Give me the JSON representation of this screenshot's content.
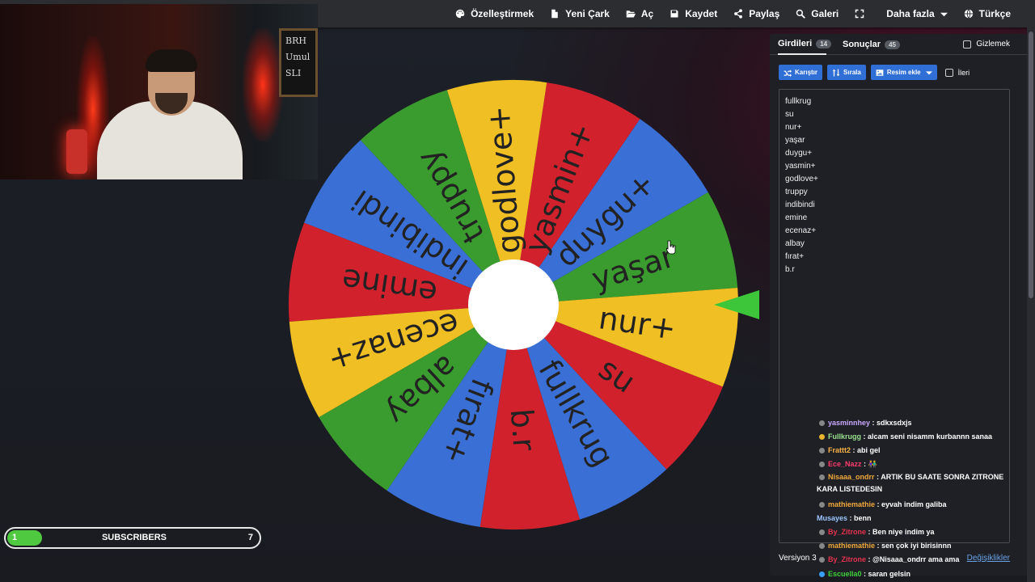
{
  "menu": {
    "customize": "Özelleştirmek",
    "new_wheel": "Yeni Çark",
    "open": "Aç",
    "save": "Kaydet",
    "share": "Paylaş",
    "gallery": "Galeri",
    "more": "Daha fazla",
    "language": "Türkçe"
  },
  "wheel": {
    "segments": [
      {
        "label": "yaşar",
        "color": "#3a9c2e"
      },
      {
        "label": "duygu+",
        "color": "#3a6fd6"
      },
      {
        "label": "yasmin+",
        "color": "#d0212d"
      },
      {
        "label": "godlove+",
        "color": "#f0bf23"
      },
      {
        "label": "truppy",
        "color": "#3a9c2e"
      },
      {
        "label": "indibindi",
        "color": "#3a6fd6"
      },
      {
        "label": "emine",
        "color": "#d0212d"
      },
      {
        "label": "ecenaz+",
        "color": "#f0bf23"
      },
      {
        "label": "albay",
        "color": "#3a9c2e"
      },
      {
        "label": "fırat+",
        "color": "#3a6fd6"
      },
      {
        "label": "b.r",
        "color": "#d0212d"
      },
      {
        "label": "fullkrug",
        "color": "#3a6fd6"
      },
      {
        "label": "su",
        "color": "#d0212d"
      },
      {
        "label": "nur+",
        "color": "#f0bf23"
      }
    ],
    "pointer_color": "#3ec63a"
  },
  "panel": {
    "tab_entries": "Girdileri",
    "entries_count": "14",
    "tab_results": "Sonuçlar",
    "results_count": "45",
    "hide_label": "Gizlemek",
    "shuffle_label": "Karıştır",
    "sort_label": "Sırala",
    "add_image_label": "Resim ekle",
    "advanced_label": "İleri",
    "entries": [
      "fullkrug",
      "su",
      "nur+",
      "yaşar",
      "duygu+",
      "yasmin+",
      "godlove+",
      "truppy",
      "indibindi",
      "emine",
      "ecenaz+",
      "albay",
      "fırat+",
      "b.r"
    ],
    "version": "Versiyon 3",
    "changes_link": "Değişiklikler"
  },
  "chat": [
    {
      "user": "yasminnhey",
      "color": "#c9a8ff",
      "badge": "#888",
      "message": ": sdkxsdxjs"
    },
    {
      "user": "Fullkrugg",
      "color": "#9be28f",
      "badge": "#e8b32d",
      "message": ": alcam seni nisamm kurbannn sanaa"
    },
    {
      "user": "Frattt2",
      "color": "#ffb347",
      "badge": "#888",
      "message": ": abi gel"
    },
    {
      "user": "Ece_Nazz",
      "color": "#ff3b6b",
      "badge": "#888",
      "message": ": 👫"
    },
    {
      "user": "Nisaaa_ondrr",
      "color": "#f2a93b",
      "badge": "#888",
      "message": ": ARTIK BU SAATE SONRA ZITRONE KARA LISTEDESIN"
    },
    {
      "user": "mathiemathie",
      "color": "#f2a93b",
      "badge": "#888",
      "message": ": eyvah indim galiba"
    },
    {
      "user": "Musayes",
      "color": "#9ec7ff",
      "badge": "",
      "message": ": benn"
    },
    {
      "user": "By_Zitrone",
      "color": "#e8324c",
      "badge": "#888",
      "message": ": Ben niye indim ya"
    },
    {
      "user": "mathiemathie",
      "color": "#f2a93b",
      "badge": "#888",
      "message": ": sen çok iyi birisinnn"
    },
    {
      "user": "By_Zitrone",
      "color": "#e8324c",
      "badge": "#888",
      "message": ": @Nisaaa_ondrr ama ama"
    },
    {
      "user": "Escuella0",
      "color": "#3ed13a",
      "badge": "#3aa0ff",
      "message": ": saran gelsin"
    }
  ],
  "subscribers": {
    "current": "1",
    "label": "SUBSCRIBERS",
    "goal": "7",
    "progress_fraction": 0.14,
    "bar_color": "#4fc93f"
  },
  "webcam": {
    "board_lines": [
      "BRH",
      "Umul",
      "SLI"
    ]
  }
}
